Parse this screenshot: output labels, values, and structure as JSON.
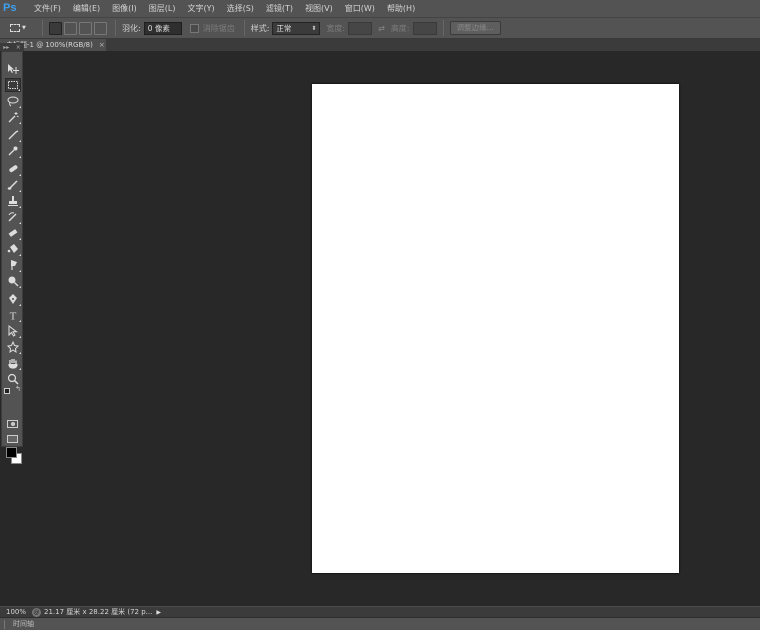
{
  "app": {
    "logo": "Ps"
  },
  "menu": [
    "文件(F)",
    "编辑(E)",
    "图像(I)",
    "图层(L)",
    "文字(Y)",
    "选择(S)",
    "滤镜(T)",
    "视图(V)",
    "窗口(W)",
    "帮助(H)"
  ],
  "options": {
    "feather_label": "羽化:",
    "feather_value": "0 像素",
    "antialias_label": "消除锯齿",
    "style_label": "样式:",
    "style_value": "正常",
    "width_label": "宽度:",
    "height_label": "高度:",
    "refine_edge_label": "调整边缘..."
  },
  "document": {
    "tab_title": "未标题-1 @ 100%(RGB/8)",
    "close": "×"
  },
  "tools_grip": {
    "left": "▸▸",
    "right": "×"
  },
  "tools": [
    "move-tool-icon",
    "rectangular-marquee-icon",
    "lasso-icon",
    "magic-wand-icon",
    "crop-icon",
    "eyedropper-icon",
    "healing-brush-icon",
    "brush-icon",
    "clone-stamp-icon",
    "history-brush-icon",
    "eraser-icon",
    "paint-bucket-icon",
    "blur-icon",
    "dodge-icon",
    "pen-icon",
    "type-icon",
    "path-selection-icon",
    "shape-icon",
    "hand-icon",
    "zoom-icon"
  ],
  "colors": {
    "foreground": "#000000",
    "background": "#ffffff",
    "canvas": "#ffffff"
  },
  "status": {
    "zoom": "100%",
    "icon": "@",
    "info": "21.17 厘米 x 28.22 厘米 (72 p...",
    "arrow": "▶"
  },
  "timeline": {
    "label": "时间轴"
  }
}
